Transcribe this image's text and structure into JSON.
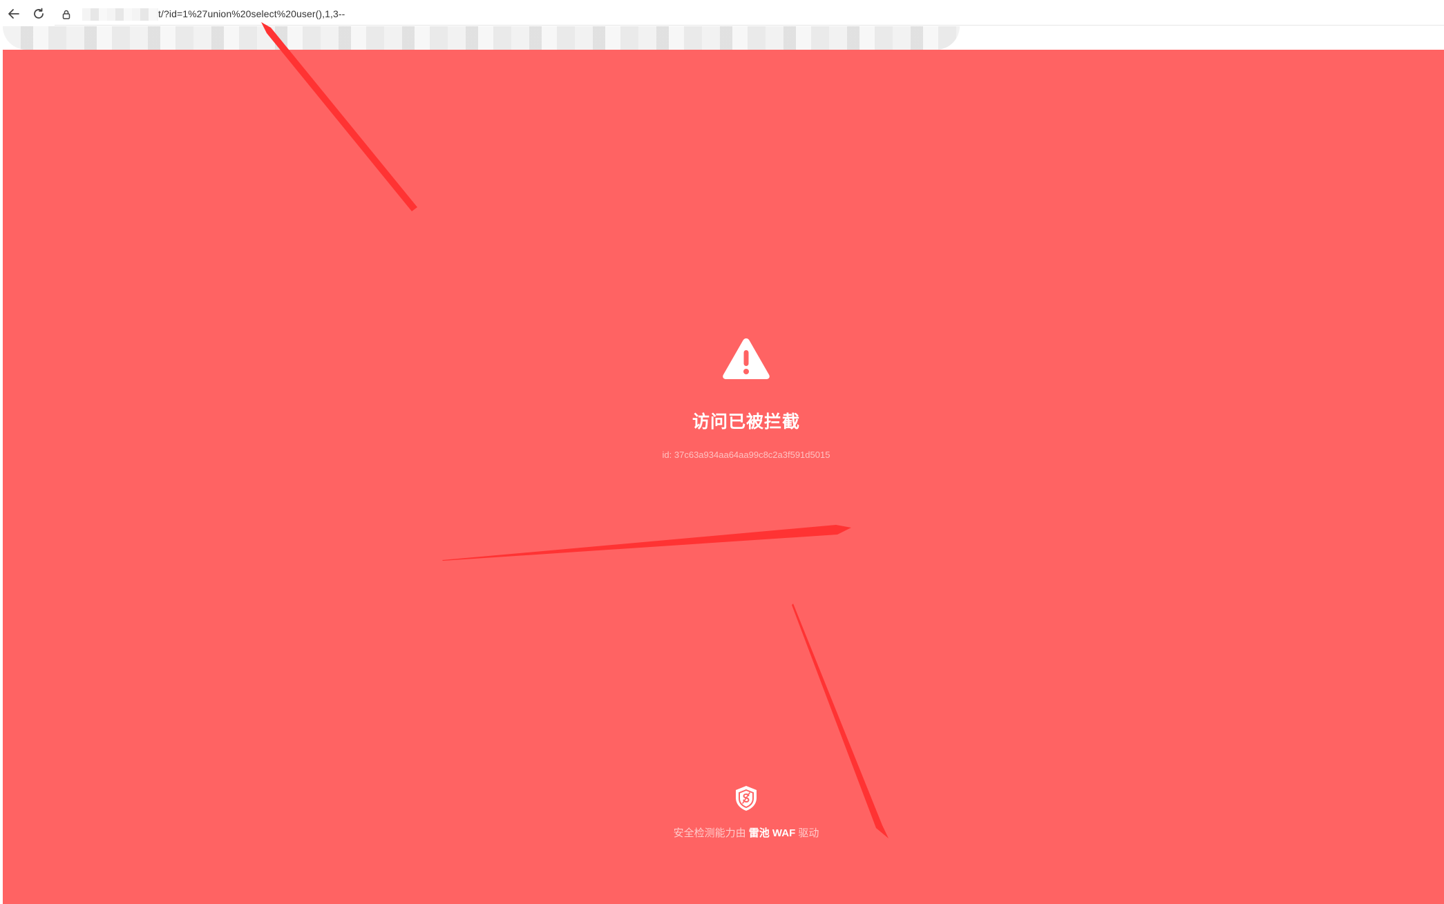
{
  "browser": {
    "address_text": "t/?id=1%27union%20select%20user(),1,3--",
    "back_icon": "back-arrow-icon",
    "reload_icon": "reload-icon",
    "site_info_icon": "lock-icon"
  },
  "block_page": {
    "background_color": "#ff6363",
    "icon": "warning-triangle-icon",
    "title": "访问已被拦截",
    "request_id": "id: 37c63a934aa64aa99c8c2a3f591d5015",
    "footer_icon": "safeline-shield-icon",
    "footer_prefix": "安全检测能力由 ",
    "footer_brand": "雷池 WAF",
    "footer_suffix": " 驱动"
  },
  "annotations": {
    "arrow_color": "#ff3333"
  }
}
